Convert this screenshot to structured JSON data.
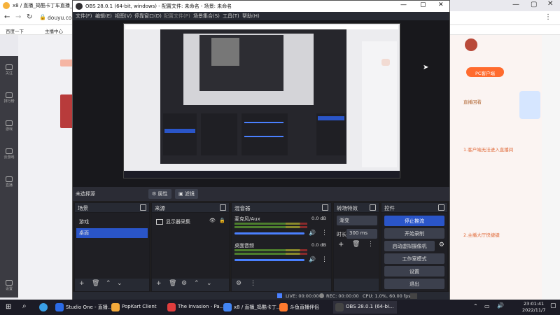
{
  "browser": {
    "tab_title": "x8 / 直播_捣酷卡丁车直播_视频",
    "address": "douyu.com",
    "bookmarks": [
      "百度一下",
      "主播中心"
    ],
    "chat_badge": "PC客户端",
    "chat_lines": [
      "直播回看",
      "1.客户端无法进入直播间",
      "2.主播大厅快捷键"
    ],
    "left_nav": [
      "关注",
      "排行榜",
      "游戏",
      "云游戏",
      "直播"
    ],
    "nav_bottom": "设置"
  },
  "obs": {
    "title": "OBS 28.0.1 (64-bit, windows) - 配置文件: 未命名 - 场景: 未命名",
    "menu": [
      "文件(F)",
      "编辑(E)",
      "视图(V)",
      "停靠窗口(D)",
      "配置文件(P)",
      "场景集合(S)",
      "工具(T)",
      "帮助(H)"
    ],
    "source_status": "未选择源",
    "properties_label": "属性",
    "filters_label": "滤镜",
    "docks": {
      "scenes": {
        "title": "场景",
        "items": [
          "游戏",
          "桌面"
        ],
        "selected": 1
      },
      "sources": {
        "title": "来源",
        "items": [
          "显示器采集"
        ]
      },
      "mixer": {
        "title": "混音器",
        "channels": [
          {
            "name": "麦克风/Aux",
            "db": "0.0 dB",
            "level": 0.95
          },
          {
            "name": "桌面音频",
            "db": "0.0 dB",
            "level": 0.95
          }
        ]
      },
      "transitions": {
        "title": "转场特效",
        "type": "渐变",
        "duration_label": "时长",
        "duration": "300 ms"
      },
      "controls": {
        "title": "控件",
        "buttons": [
          "停止推流",
          "开始录制",
          "启动虚拟摄像机",
          "工作室模式",
          "设置",
          "退出"
        ]
      }
    },
    "status": {
      "live": "LIVE: 00:00:00",
      "rec": "REC: 00:00:00",
      "cpu": "CPU: 1.0%, 60.00 fps"
    }
  },
  "taskbar": {
    "items": [
      {
        "label": "Studio One - 直播...",
        "color": "#2b6be6"
      },
      {
        "label": "PopKart Client",
        "color": "#f2a93b"
      },
      {
        "label": "The Invasion - Pa...",
        "color": "#e03d3d"
      },
      {
        "label": "x8 / 直播_捣酷卡丁...",
        "color": "#4285f4"
      },
      {
        "label": "斗鱼直播伴侣",
        "color": "#ff7a2e"
      },
      {
        "label": "OBS 28.0.1 (64-bi...",
        "color": "#444"
      }
    ],
    "time": "23:01:41",
    "date": "2022/11/7"
  }
}
